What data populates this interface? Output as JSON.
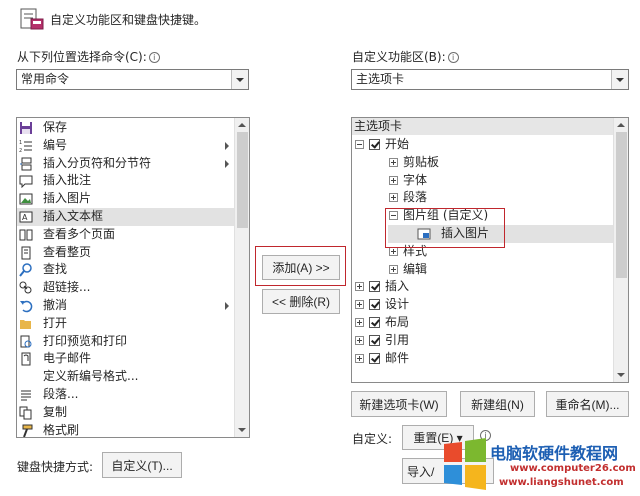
{
  "header": {
    "title": "自定义功能区和键盘快捷键。"
  },
  "left": {
    "label": "从下列位置选择命令(C):",
    "combo_value": "常用命令",
    "items": [
      {
        "label": "保存",
        "icon": "save-icon",
        "sub": false
      },
      {
        "label": "编号",
        "icon": "numbering-icon",
        "sub": true
      },
      {
        "label": "插入分页符和分节符",
        "icon": "page-break-icon",
        "sub": true
      },
      {
        "label": "插入批注",
        "icon": "comment-icon",
        "sub": false
      },
      {
        "label": "插入图片",
        "icon": "picture-icon",
        "sub": false
      },
      {
        "label": "插入文本框",
        "icon": "textbox-icon",
        "sub": false,
        "selected": true
      },
      {
        "label": "查看多个页面",
        "icon": "multiple-pages-icon",
        "sub": false
      },
      {
        "label": "查看整页",
        "icon": "one-page-icon",
        "sub": false
      },
      {
        "label": "查找",
        "icon": "find-icon",
        "sub": false
      },
      {
        "label": "超链接...",
        "icon": "hyperlink-icon",
        "sub": false
      },
      {
        "label": "撤消",
        "icon": "undo-icon",
        "sub": true
      },
      {
        "label": "打开",
        "icon": "open-folder-icon",
        "sub": false
      },
      {
        "label": "打印预览和打印",
        "icon": "print-preview-icon",
        "sub": false
      },
      {
        "label": "电子邮件",
        "icon": "email-icon",
        "sub": false
      },
      {
        "label": "定义新编号格式...",
        "icon": "none",
        "sub": false
      },
      {
        "label": "段落...",
        "icon": "paragraph-icon",
        "sub": false
      },
      {
        "label": "复制",
        "icon": "copy-icon",
        "sub": false
      },
      {
        "label": "格式刷",
        "icon": "format-painter-icon",
        "sub": false
      }
    ]
  },
  "middle": {
    "add_button": "添加(A) >>",
    "remove_button": "<< 删除(R)"
  },
  "right": {
    "label": "自定义功能区(B):",
    "combo_value": "主选项卡",
    "tree_header": "主选项卡",
    "tree": [
      {
        "label": "开始",
        "level": 0,
        "expander": "minus",
        "checkbox": true
      },
      {
        "label": "剪贴板",
        "level": 1,
        "expander": "plus",
        "checkbox": false
      },
      {
        "label": "字体",
        "level": 1,
        "expander": "plus",
        "checkbox": false
      },
      {
        "label": "段落",
        "level": 1,
        "expander": "plus",
        "checkbox": false
      },
      {
        "label": "图片组 (自定义)",
        "level": 1,
        "expander": "minus",
        "checkbox": false
      },
      {
        "label": "插入图片",
        "level": 2,
        "expander": "none",
        "checkbox": false,
        "selected": true
      },
      {
        "label": "样式",
        "level": 1,
        "expander": "plus",
        "checkbox": false
      },
      {
        "label": "编辑",
        "level": 1,
        "expander": "plus",
        "checkbox": false
      },
      {
        "label": "插入",
        "level": 0,
        "expander": "plus",
        "checkbox": true
      },
      {
        "label": "设计",
        "level": 0,
        "expander": "plus",
        "checkbox": true
      },
      {
        "label": "布局",
        "level": 0,
        "expander": "plus",
        "checkbox": true
      },
      {
        "label": "引用",
        "level": 0,
        "expander": "plus",
        "checkbox": true
      },
      {
        "label": "邮件",
        "level": 0,
        "expander": "plus",
        "checkbox": true
      }
    ],
    "new_tab_button": "新建选项卡(W)",
    "new_group_button": "新建组(N)",
    "rename_button": "重命名(M)...",
    "customize_label": "自定义:",
    "reset_button": "重置(E) ▾",
    "import_export_button": "导入/"
  },
  "footer": {
    "shortcut_label": "键盘快捷方式:",
    "customize_button": "自定义(T)..."
  },
  "watermark": {
    "title": "电脑软硬件教程网",
    "url1": "www.computer26.com",
    "url2": "www.liangshunet.com",
    "colors": [
      "#e94b2c",
      "#7cb82f",
      "#2e8fd9",
      "#f5b51d"
    ]
  }
}
